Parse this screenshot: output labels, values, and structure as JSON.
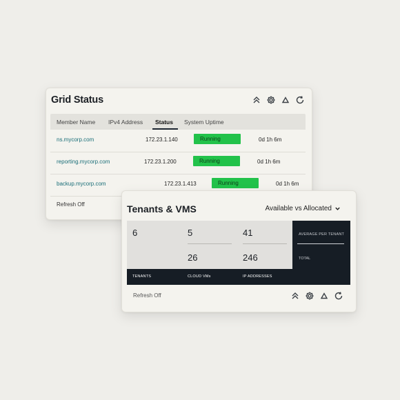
{
  "grid_status": {
    "title": "Grid Status",
    "icons": [
      "chevrons-up-icon",
      "gear-icon",
      "triangle-up-icon",
      "refresh-icon"
    ],
    "columns": [
      "Member Name",
      "IPv4 Address",
      "Status",
      "System Uptime"
    ],
    "active_column": "Status",
    "rows": [
      {
        "name": "ns.mycorp.com",
        "ip": "172.23.1.140",
        "status": "Running",
        "uptime": "0d 1h 6m"
      },
      {
        "name": "reporting.mycorp.com",
        "ip": "172.23.1.200",
        "status": "Running",
        "uptime": "0d 1h 6m"
      },
      {
        "name": "backup.mycorp.com",
        "ip": "172.23.1.413",
        "status": "Running",
        "uptime": "0d 1h 6m"
      }
    ],
    "refresh": "Refresh Off",
    "status_color": "#22c24a"
  },
  "tenants": {
    "title": "Tenants & VMS",
    "dropdown": "Available vs Allocated",
    "available": {
      "tenants": "6",
      "cloud_vms": "5",
      "ip_addresses": "41"
    },
    "allocated": {
      "cloud_vms": "26",
      "ip_addresses": "246"
    },
    "labels": {
      "tenants": "TENANTS",
      "cloud_vms": "CLOUD VMs",
      "ip_addresses": "IP ADDRESSES"
    },
    "side": {
      "average": "AVERAGE PER TENANT",
      "total": "TOTAL"
    },
    "refresh": "Refresh Off",
    "icons": [
      "chevrons-up-icon",
      "gear-icon",
      "triangle-up-icon",
      "refresh-icon"
    ],
    "dark_color": "#161d25"
  }
}
